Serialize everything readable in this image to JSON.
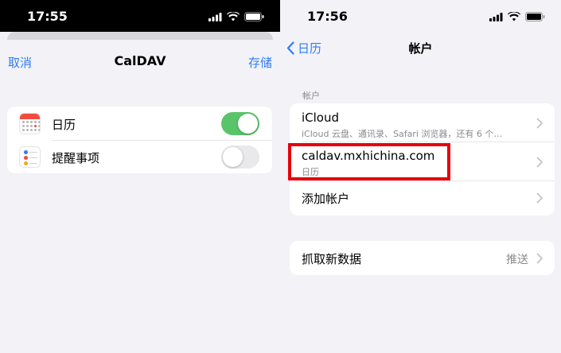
{
  "left": {
    "status_time": "17:55",
    "sheet": {
      "cancel": "取消",
      "title": "CalDAV",
      "save": "存储",
      "rows": [
        {
          "label": "日历",
          "icon": "calendar-icon",
          "toggle": true
        },
        {
          "label": "提醒事项",
          "icon": "reminders-icon",
          "toggle": false
        }
      ]
    }
  },
  "right": {
    "status_time": "17:56",
    "back_label": "日历",
    "title": "帐户",
    "section_label": "帐户",
    "accounts": [
      {
        "title": "iCloud",
        "subtitle": "iCloud 云盘、通讯录、Safari 浏览器，还有 6 个…"
      },
      {
        "title": "caldav.mxhichina.com",
        "subtitle": "日历"
      },
      {
        "title": "添加帐户"
      }
    ],
    "fetch": {
      "label": "抓取新数据",
      "value": "推送"
    }
  },
  "colors": {
    "accent": "#2f7cf6",
    "toggle_on": "#5ac46a",
    "highlight": "#e8000b"
  }
}
